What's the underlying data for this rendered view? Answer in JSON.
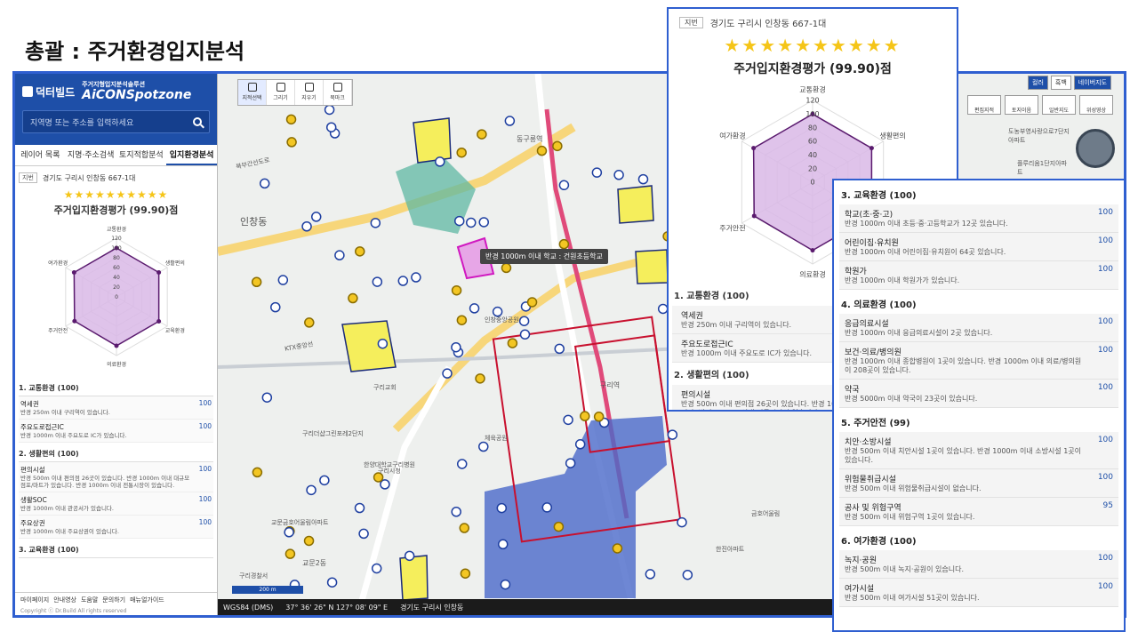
{
  "slide_title": "총괄 : 주거환경입지분석",
  "sidebar": {
    "logo_left": "덕터빌드",
    "logo_right": "AiCONSpotzone",
    "logo_tagline": "주거지형입지분석솔루션",
    "search_placeholder": "지역명 또는 주소를 입력하세요",
    "tabs": [
      "레이어 목록",
      "지명·주소검색",
      "토지적합분석",
      "입지환경분석"
    ],
    "address_tag": "지번",
    "address": "경기도 구리시 인창동 667-1대",
    "stars": "★★★★★★★★★★",
    "score_title": "주거입지환경평가 (99.90)점",
    "radar_ticks": [
      "120",
      "100",
      "80",
      "60",
      "40",
      "20",
      "0"
    ],
    "radar_axes": [
      "교통환경",
      "생활편의",
      "교육환경",
      "의료환경",
      "주거안전",
      "여가환경"
    ],
    "categories": [
      {
        "title": "1. 교통환경 (100)",
        "items": [
          {
            "name": "역세권",
            "desc": "반경 250m 이내 구리역이 있습니다.",
            "score": "100"
          },
          {
            "name": "주요도로접근IC",
            "desc": "반경 1000m 이내 주요도로 IC가 있습니다.",
            "score": "100"
          }
        ]
      },
      {
        "title": "2. 생활편의 (100)",
        "items": [
          {
            "name": "편의시설",
            "desc": "반경 500m 이내 편의점 26곳이 있습니다. 반경 1000m 이내 대규모점포/마트가 있습니다. 반경 1000m 이내 전통시장이 있습니다.",
            "score": "100"
          },
          {
            "name": "생활SOC",
            "desc": "반경 1000m 이내 관공서가 있습니다.",
            "score": "100"
          },
          {
            "name": "주요상권",
            "desc": "반경 1000m 이내 주요상권이 있습니다.",
            "score": "100"
          }
        ]
      },
      {
        "title": "3. 교육환경 (100)",
        "items": []
      }
    ],
    "footer_links": [
      "마이페이지",
      "안내영상",
      "도움말",
      "문의하기",
      "매뉴얼가이드"
    ],
    "copyright": "Copyright ⓒ Dr.Build All rights reserved"
  },
  "map": {
    "tools": [
      "지적선택",
      "그리기",
      "지우기",
      "북마크"
    ],
    "tooltip": "반경 1000m 이내 학교 : 건원초등학교",
    "labels": [
      "인창동",
      "북부간선도로",
      "동구릉역",
      "구리역",
      "KTX중앙선",
      "인창중앙공원",
      "체육공원",
      "구리시청",
      "구리교회",
      "교문2동",
      "구리경찰서",
      "한양대학교구리병원",
      "구리더샵그린포레2단지",
      "교문금호어울림아파트",
      "금호어울림",
      "한진아파트"
    ],
    "scale": "200 m",
    "status": [
      "WGS84 (DMS)",
      "37° 36' 26\" N 127° 08' 09\" E",
      "경기도 구리시 인창동"
    ],
    "right_ctrls": [
      "컬러",
      "흑백",
      "네이버지도"
    ],
    "layer_btns": [
      "편집지적",
      "토지이음",
      "일반지도",
      "위성영상"
    ],
    "right_labels": [
      "도농부영사랑으로7단지아파트",
      "플루리움1단지아파트"
    ]
  },
  "panel_a": {
    "address_tag": "지번",
    "address": "경기도 구리시 인창동 667-1대",
    "stars": "★★★★★★★★★★",
    "score_title": "주거입지환경평가 (99.90)점",
    "radar_ticks": [
      "120",
      "100",
      "80",
      "60",
      "40",
      "20",
      "0"
    ],
    "radar_axes": [
      "교통환경",
      "생활편의",
      "교육환경",
      "의료환경",
      "주거안전",
      "여가환경"
    ],
    "categories": [
      {
        "title": "1. 교통환경 (100)",
        "items": [
          {
            "name": "역세권",
            "desc": "반경 250m 이내 구리역이 있습니다."
          },
          {
            "name": "주요도로접근IC",
            "desc": "반경 1000m 이내 주요도로 IC가 있습니다."
          }
        ]
      },
      {
        "title": "2. 생활편의 (100)",
        "items": [
          {
            "name": "편의시설",
            "desc": "반경 500m 이내 편의점 26곳이 있습니다. 반경 1000m 이내 대규모점포/마트가 있습니다. 반경 1000m 이내 전통시장이 있습니다."
          },
          {
            "name": "생활SOC",
            "desc": "반경 1000m 이내 관공서가 있습니다."
          },
          {
            "name": "주요상권",
            "desc": "반경 1000m 이내 주요상권이 있습니다."
          }
        ]
      }
    ]
  },
  "panel_b": {
    "categories": [
      {
        "title": "3. 교육환경 (100)",
        "items": [
          {
            "name": "학교(초·중·고)",
            "desc": "반경 1000m 이내 초등·중·고등학교가 12곳 있습니다.",
            "score": "100"
          },
          {
            "name": "어린이집·유치원",
            "desc": "반경 1000m 이내 어린이집·유치원이 64곳 있습니다.",
            "score": "100"
          },
          {
            "name": "학원가",
            "desc": "반경 1000m 이내 학원가가 있습니다.",
            "score": "100"
          }
        ]
      },
      {
        "title": "4. 의료환경 (100)",
        "items": [
          {
            "name": "응급의료시설",
            "desc": "반경 1000m 이내 응급의료시설이 2곳 있습니다.",
            "score": "100"
          },
          {
            "name": "보건·의료/병의원",
            "desc": "반경 1000m 이내 종합병원이 1곳이 있습니다. 반경 1000m 이내 의료/병의원이 208곳이 있습니다.",
            "score": "100"
          },
          {
            "name": "약국",
            "desc": "반경 5000m 이내 약국이 23곳이 있습니다.",
            "score": "100"
          }
        ]
      },
      {
        "title": "5. 주거안전 (99)",
        "items": [
          {
            "name": "치안·소방시설",
            "desc": "반경 500m 이내 치안시설 1곳이 있습니다. 반경 1000m 이내 소방시설 1곳이 있습니다.",
            "score": "100"
          },
          {
            "name": "위험물취급시설",
            "desc": "반경 500m 이내 위험물취급시설이 없습니다.",
            "score": "100"
          },
          {
            "name": "공사 및 위험구역",
            "desc": "반경 500m 이내 위험구역 1곳이 있습니다.",
            "score": "95"
          }
        ]
      },
      {
        "title": "6. 여가환경 (100)",
        "items": [
          {
            "name": "녹지·공원",
            "desc": "반경 500m 이내 녹지·공원이 있습니다.",
            "score": "100"
          },
          {
            "name": "여가시설",
            "desc": "반경 500m 이내 여가시설 51곳이 있습니다.",
            "score": "100"
          }
        ]
      }
    ]
  },
  "radar_values": [
    100,
    100,
    100,
    100,
    99,
    100
  ],
  "colors": {
    "brand": "#1e4fa8",
    "frame": "#2f5fd0",
    "radar_fill": "#d9b9e6",
    "radar_stroke": "#5a1a6e",
    "star": "#f5c518"
  }
}
